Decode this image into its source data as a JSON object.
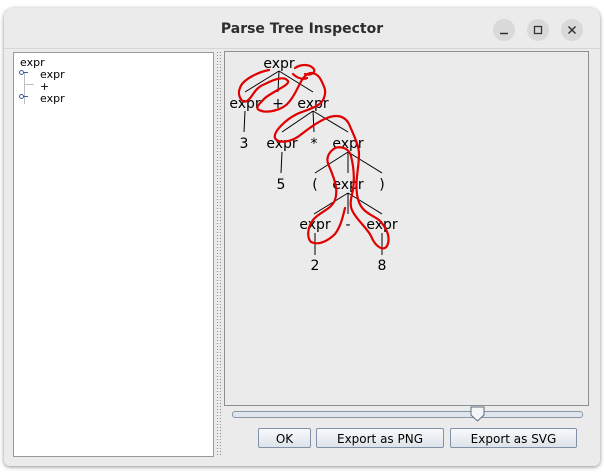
{
  "window": {
    "title": "Parse Tree Inspector"
  },
  "window_controls": [
    "minimize-icon",
    "maximize-icon",
    "close-icon"
  ],
  "tree_view": {
    "root": "expr",
    "children": [
      "expr",
      "+",
      "expr"
    ]
  },
  "parse_tree": {
    "nodes": [
      "expr",
      "expr",
      "+",
      "expr",
      "3",
      "expr",
      "*",
      "expr",
      "5",
      "(",
      "expr",
      ")",
      "expr",
      "-",
      "expr",
      "2",
      "8"
    ]
  },
  "zoom_slider": {
    "value": 0.7
  },
  "buttons": {
    "ok": "OK",
    "export_png": "Export as PNG",
    "export_svg": "Export as SVG"
  },
  "colors": {
    "annotation_stroke": "#e00000"
  }
}
